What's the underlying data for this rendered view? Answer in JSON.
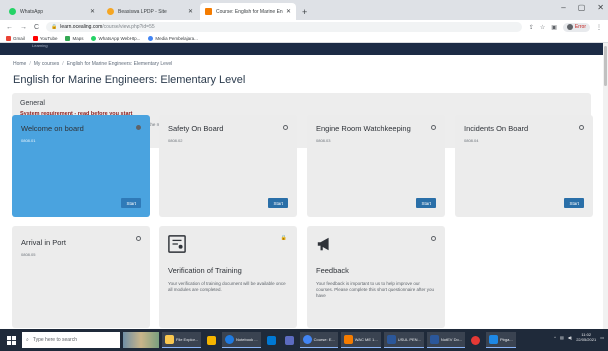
{
  "browser": {
    "tabs": [
      {
        "label": "WhatsApp",
        "favicon_color": "#25d366",
        "active": false
      },
      {
        "label": "Beasiswa LPDP - Site",
        "favicon_color": "#f5a623",
        "active": false
      },
      {
        "label": "Course: English for Marine Engin",
        "favicon_color": "#f57c00",
        "active": true
      }
    ],
    "new_tab": "+",
    "window_controls": {
      "minimize": "–",
      "maximize": "▢",
      "close": "✕"
    },
    "back": "←",
    "forward": "→",
    "reload": "C",
    "url_host": "learn.ocealing.com",
    "url_path": "/course/view.php?id=55",
    "profile_label": "Error",
    "bookmarks": [
      {
        "label": "Gmail",
        "color": "#ea4335"
      },
      {
        "label": "YouTube",
        "color": "#ff0000"
      },
      {
        "label": "Maps",
        "color": "#34a853"
      },
      {
        "label": "WhatsApp WebHtp...",
        "color": "#25d366"
      },
      {
        "label": "Media Pembelajara...",
        "color": "#4285f4"
      }
    ]
  },
  "site": {
    "nav_text": "Learning",
    "breadcrumb": [
      "Home",
      "My courses",
      "English for Marine Engineers: Elementary Level"
    ],
    "breadcrumb_sep": "/",
    "course_title": "English for Marine Engineers: Elementary Level",
    "general": {
      "heading": "General",
      "requirement": "System requirement - read before you start",
      "text_before": "Test your ",
      "link1": "speaker / headphone",
      "text_mid": " and ",
      "link2": "microphone",
      "text_after": " before you start the module."
    },
    "cards": [
      {
        "title": "Welcome on board",
        "code": "0808.01",
        "button": "Start",
        "active": true
      },
      {
        "title": "Safety On Board",
        "code": "0808.02",
        "button": "Start",
        "active": false
      },
      {
        "title": "Engine Room Watchkeeping",
        "code": "0808.03",
        "button": "Start",
        "active": false
      },
      {
        "title": "Incidents On Board",
        "code": "0808.04",
        "button": "Start",
        "active": false
      },
      {
        "title": "Arrival in Port",
        "code": "0808.05",
        "active": false
      },
      {
        "title": "Verification of Training",
        "description": "Your verification of training document will be available once all modules are completed.",
        "icon": "certificate-icon",
        "locked": true
      },
      {
        "title": "Feedback",
        "description": "Your feedback is important to us to help improve our courses. Please complete this short questionnaire after you have",
        "icon": "megaphone-icon"
      }
    ]
  },
  "taskbar": {
    "search_placeholder": "Type here to search",
    "items": [
      {
        "label": "File Explor...",
        "color": "#f9c74f"
      },
      {
        "label": "Notebook ...",
        "color": "#1f7ae0"
      },
      {
        "label": "Course: E...",
        "color": "#4285f4"
      },
      {
        "label": "WAC ME 1...",
        "color": "#f57c00"
      },
      {
        "label": "USUL PEN...",
        "color": "#2b579a"
      },
      {
        "label": "NotEV Do...",
        "color": "#2b579a"
      },
      {
        "label": "Pbga...",
        "color": "#1e88e5"
      }
    ],
    "time": "11:02",
    "date": "22/05/2021"
  }
}
